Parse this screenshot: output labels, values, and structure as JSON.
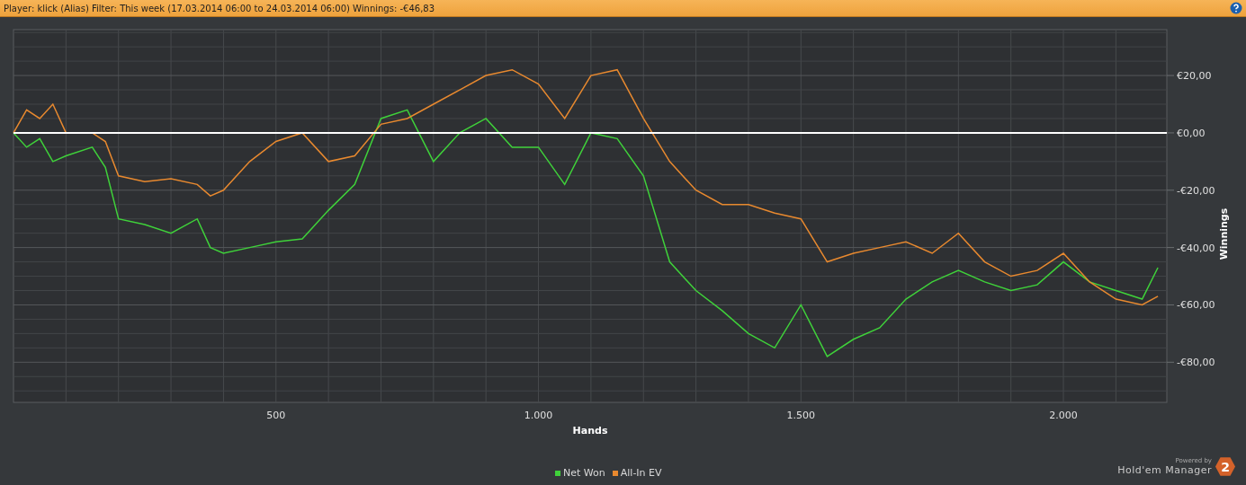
{
  "header": {
    "text": "Player: klick (Alias) Filter: This week (17.03.2014 06:00 to 24.03.2014 06:00) Winnings: -€46,83"
  },
  "chart": {
    "chart_data": {
      "type": "line",
      "xlabel": "Hands",
      "ylabel": "Winnings",
      "x": [
        0,
        25,
        50,
        75,
        100,
        150,
        175,
        200,
        250,
        300,
        350,
        375,
        400,
        450,
        500,
        550,
        600,
        650,
        700,
        750,
        800,
        850,
        900,
        950,
        1000,
        1050,
        1100,
        1150,
        1200,
        1250,
        1300,
        1350,
        1400,
        1450,
        1500,
        1550,
        1600,
        1650,
        1700,
        1750,
        1800,
        1850,
        1900,
        1950,
        2000,
        2050,
        2100,
        2150,
        2180
      ],
      "series": [
        {
          "name": "Net Won",
          "color": "#3fd13a",
          "values": [
            0,
            -5,
            -2,
            -10,
            -8,
            -5,
            -12,
            -30,
            -32,
            -35,
            -30,
            -40,
            -42,
            -40,
            -38,
            -37,
            -27,
            -18,
            5,
            8,
            -10,
            0,
            5,
            -5,
            -5,
            -18,
            0,
            -2,
            -15,
            -45,
            -55,
            -62,
            -70,
            -75,
            -60,
            -78,
            -72,
            -68,
            -58,
            -52,
            -48,
            -52,
            -55,
            -53,
            -45,
            -52,
            -55,
            -58,
            -47
          ]
        },
        {
          "name": "All-In EV",
          "color": "#e8892f",
          "values": [
            0,
            8,
            5,
            10,
            0,
            0,
            -3,
            -15,
            -17,
            -16,
            -18,
            -22,
            -20,
            -10,
            -3,
            0,
            -10,
            -8,
            3,
            5,
            10,
            15,
            20,
            22,
            17,
            5,
            20,
            22,
            5,
            -10,
            -20,
            -25,
            -25,
            -28,
            -30,
            -45,
            -42,
            -40,
            -38,
            -42,
            -35,
            -45,
            -50,
            -48,
            -42,
            -52,
            -58,
            -60,
            -57
          ]
        }
      ],
      "grid": true,
      "xlim": [
        0,
        2197
      ],
      "ylim": [
        -94,
        36
      ],
      "xticks": [
        {
          "value": 500,
          "label": "500"
        },
        {
          "value": 1000,
          "label": "1.000"
        },
        {
          "value": 1500,
          "label": "1.500"
        },
        {
          "value": 2000,
          "label": "2.000"
        }
      ],
      "yticks": [
        {
          "value": 20,
          "label": "€20,00"
        },
        {
          "value": 0,
          "label": "€0,00"
        },
        {
          "value": -20,
          "label": "-€20,00"
        },
        {
          "value": -40,
          "label": "-€40,00"
        },
        {
          "value": -60,
          "label": "-€60,00"
        },
        {
          "value": -80,
          "label": "-€80,00"
        }
      ]
    }
  },
  "branding": {
    "tagline": "Powered by",
    "product": "Hold'em Manager",
    "logo_mark": "2"
  }
}
